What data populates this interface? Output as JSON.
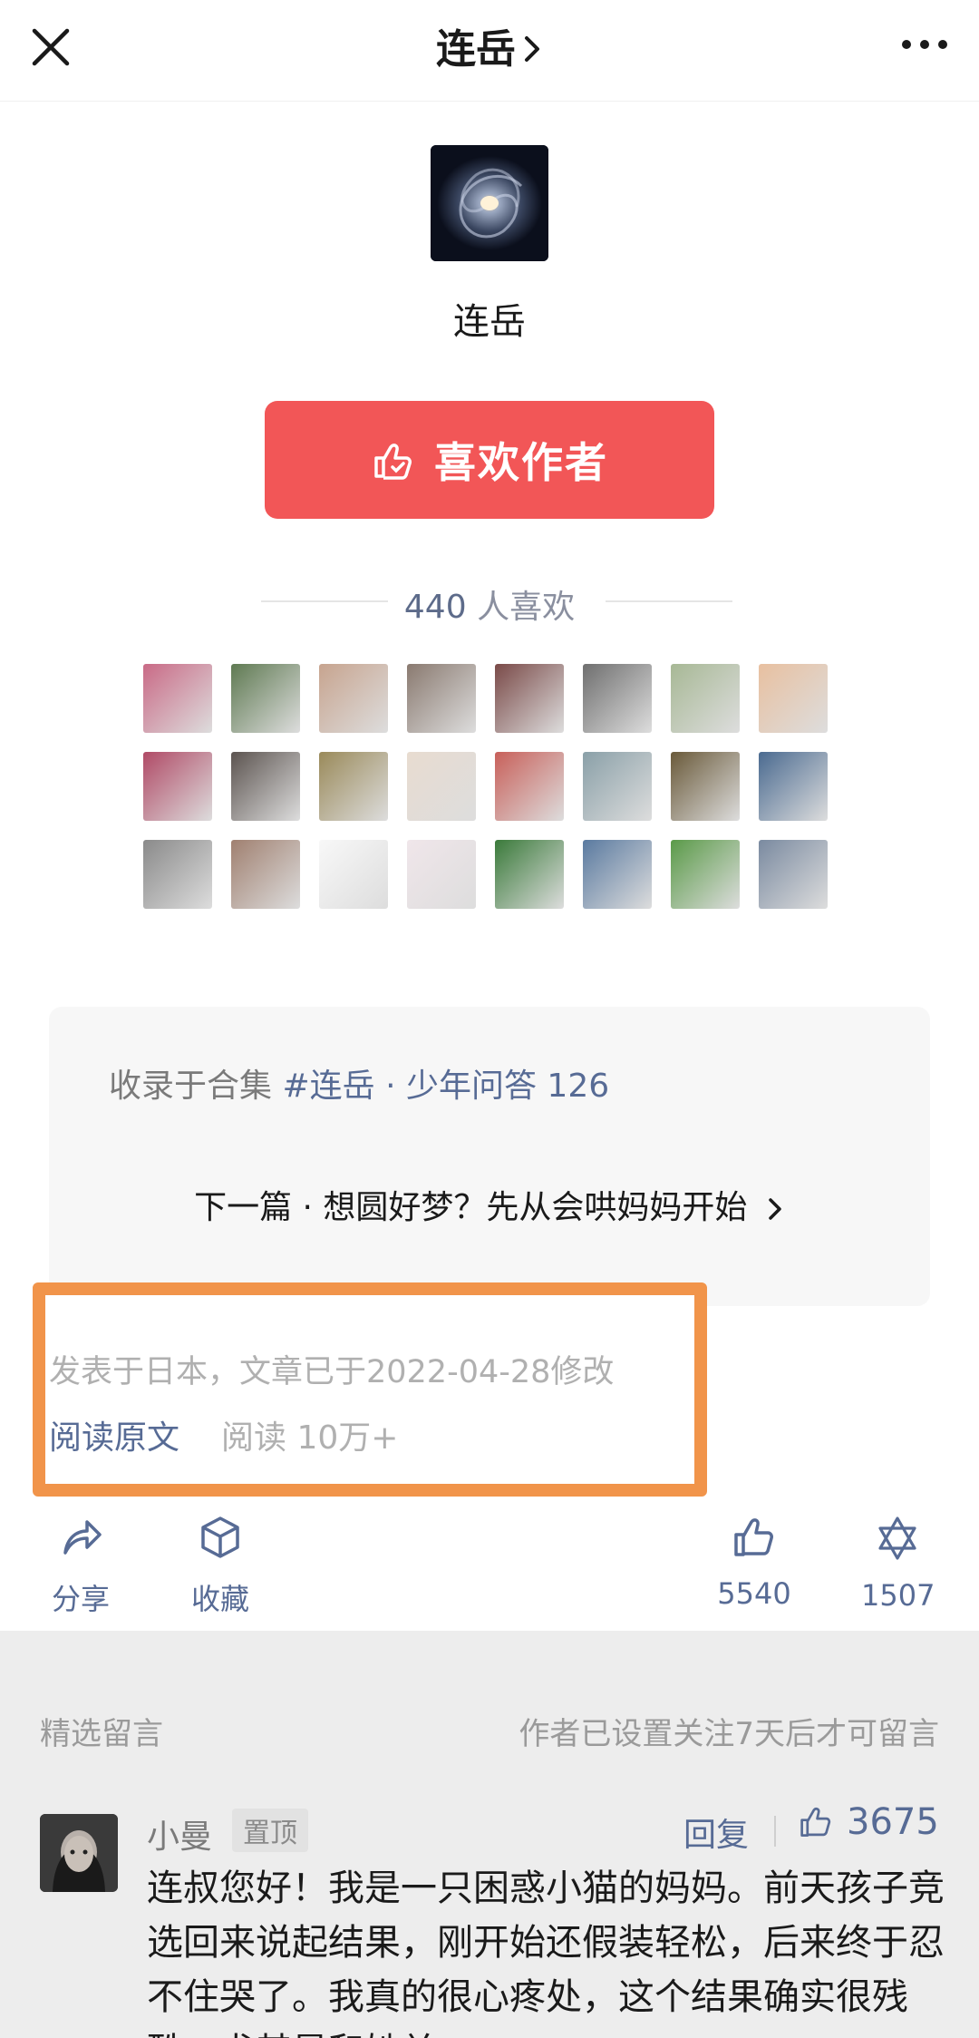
{
  "topbar": {
    "title": "连岳",
    "close_icon": "close-icon",
    "more_icon": "more-dots-icon"
  },
  "author": {
    "name": "连岳",
    "like_button_label": "喜欢作者",
    "likers_count": "440",
    "likers_suffix": "人喜欢"
  },
  "liker_avatars": [
    {
      "name": "flowers",
      "color": "#c96a86"
    },
    {
      "name": "scooter-man",
      "color": "#5f7a52"
    },
    {
      "name": "woman",
      "color": "#c7a48f"
    },
    {
      "name": "woman-room",
      "color": "#8a7a70"
    },
    {
      "name": "car-interior",
      "color": "#7a4a48"
    },
    {
      "name": "man-portrait",
      "color": "#6f6f6f"
    },
    {
      "name": "bird",
      "color": "#a7b895"
    },
    {
      "name": "child-red",
      "color": "#e8c0a0"
    },
    {
      "name": "roses",
      "color": "#b04a66"
    },
    {
      "name": "reading",
      "color": "#5c5450"
    },
    {
      "name": "giraffe",
      "color": "#9a8a5a"
    },
    {
      "name": "anime-girl",
      "color": "#e8dcd0"
    },
    {
      "name": "plumeria",
      "color": "#c8605a"
    },
    {
      "name": "van",
      "color": "#8aa0a8"
    },
    {
      "name": "night-lights",
      "color": "#6a5a3a"
    },
    {
      "name": "sky",
      "color": "#4a6a90"
    },
    {
      "name": "bw-path",
      "color": "#8a8a8a"
    },
    {
      "name": "mother-child",
      "color": "#a08070"
    },
    {
      "name": "text-note",
      "color": "#f8f8f8"
    },
    {
      "name": "cartoon-girl",
      "color": "#f0e6ea"
    },
    {
      "name": "green-forest",
      "color": "#3a7a3a"
    },
    {
      "name": "tom-cat",
      "color": "#5a7aa0"
    },
    {
      "name": "fern",
      "color": "#5a9a48"
    },
    {
      "name": "sunset",
      "color": "#7a8aa0"
    }
  ],
  "collection": {
    "prefix": "收录于合集",
    "tag": "#连岳 · 少年问答",
    "count": "126",
    "next_article": "下一篇 · 想圆好梦？先从会哄妈妈开始"
  },
  "meta": {
    "published": "发表于日本，文章已于2022-04-28修改",
    "read_original": "阅读原文",
    "read_count": "阅读 10万+"
  },
  "actions": {
    "share": "分享",
    "favorite": "收藏",
    "likes": "5540",
    "wow": "1507"
  },
  "comments": {
    "title": "精选留言",
    "note": "作者已设置关注7天后才可留言",
    "first": {
      "name": "小曼",
      "badge": "置顶",
      "reply": "回复",
      "likes": "3675",
      "text": "连叔您好！我是一只困惑小猫的妈妈。前天孩子竞选回来说起结果，刚开始还假装轻松，后来终于忍不住哭了。我真的很心疼处，这个结果确实很残酷，尤其是和她关"
    }
  },
  "colors": {
    "accent_red": "#f25657",
    "link_blue": "#576b95",
    "highlight_orange": "#f1944a"
  }
}
